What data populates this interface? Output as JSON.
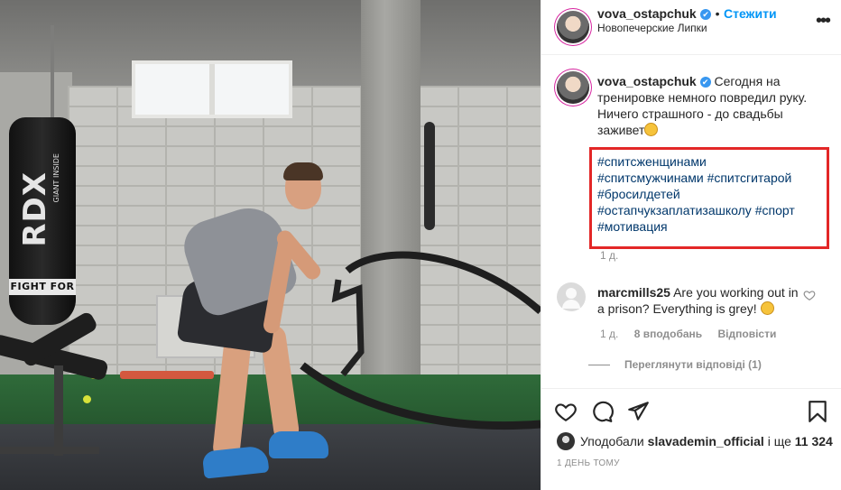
{
  "post": {
    "header": {
      "username": "vova_ostapchuk",
      "verified_mark": "✔",
      "separator": "•",
      "follow_label": "Стежити",
      "location": "Новопечерские Липки",
      "more_glyph": "•••"
    },
    "caption": {
      "username": "vova_ostapchuk",
      "text": "Сегодня на тренировке немного повредил руку. Ничего страшного - до свадьбы заживет",
      "hashtags": [
        "#спитсженщинами",
        "#спитсмужчинами",
        "#спитсгитарой",
        "#бросилдетей",
        "#остапчукзаплатизашколу",
        "#спорт",
        "#мотивация"
      ],
      "time": "1 д."
    },
    "comment": {
      "username": "marcmills25",
      "text": "Are you working out in a prison? Everything is grey!",
      "time": "1 д.",
      "likes": "8 вподобань",
      "reply_label": "Відповісти",
      "view_replies": "Переглянути відповіді (1)"
    },
    "likes_line": {
      "prefix": "Уподобали",
      "user": "slavademin_official",
      "middle": "і ще",
      "count": "11 324"
    },
    "date": "1 ДЕНЬ ТОМУ",
    "photo": {
      "bag_brand": "RDX",
      "bag_sub": "GIANT INSIDE",
      "bag_band": "FIGHT FOR"
    },
    "colors": {
      "link": "#00376b",
      "follow": "#0095f6",
      "highlight_box": "#e32727"
    }
  }
}
